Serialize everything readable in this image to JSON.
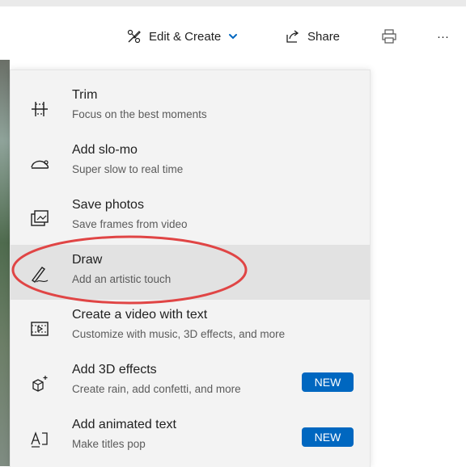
{
  "toolbar": {
    "edit_label": "Edit & Create",
    "share_label": "Share",
    "more_label": "···"
  },
  "menu": {
    "items": [
      {
        "title": "Trim",
        "subtitle": "Focus on the best moments",
        "icon": "trim-icon"
      },
      {
        "title": "Add slo-mo",
        "subtitle": "Super slow to real time",
        "icon": "slowmo-icon"
      },
      {
        "title": "Save photos",
        "subtitle": "Save frames from video",
        "icon": "save-photos-icon"
      },
      {
        "title": "Draw",
        "subtitle": "Add an artistic touch",
        "icon": "draw-icon"
      },
      {
        "title": "Create a video with text",
        "subtitle": "Customize with music, 3D effects, and more",
        "icon": "video-text-icon"
      },
      {
        "title": "Add 3D effects",
        "subtitle": "Create rain, add confetti, and more",
        "icon": "3d-effects-icon",
        "badge": "NEW"
      },
      {
        "title": "Add animated text",
        "subtitle": "Make titles pop",
        "icon": "animated-text-icon",
        "badge": "NEW"
      }
    ]
  },
  "colors": {
    "accent": "#0067c0",
    "highlight_red": "#e04545",
    "active_bg": "#e2e2e2",
    "menu_bg": "#f3f3f3"
  }
}
